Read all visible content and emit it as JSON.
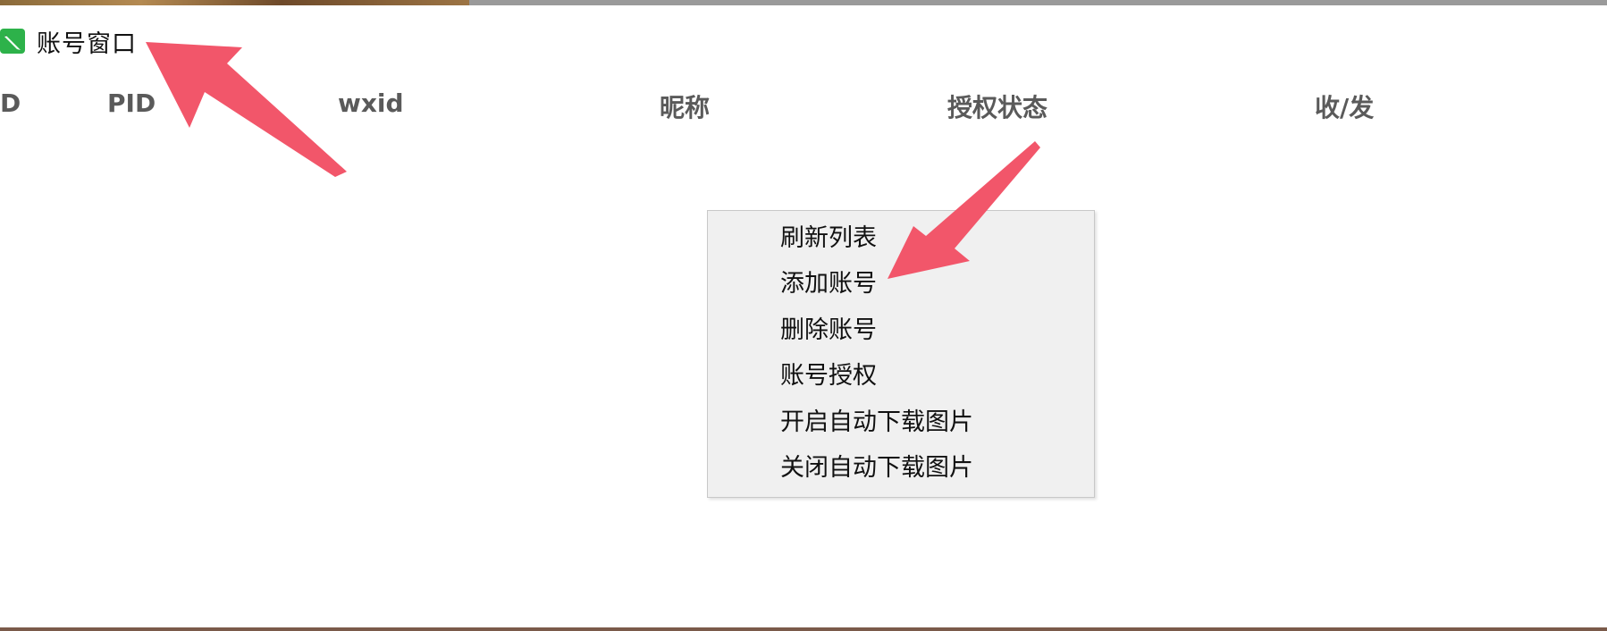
{
  "window": {
    "title": "账号窗口",
    "icon": "pen-app-icon"
  },
  "table": {
    "columns": [
      "D",
      "PID",
      "wxid",
      "昵称",
      "授权状态",
      "收/发"
    ],
    "rows": []
  },
  "context_menu": {
    "items": [
      "刷新列表",
      "添加账号",
      "删除账号",
      "账号授权",
      "开启自动下载图片",
      "关闭自动下载图片"
    ]
  },
  "colors": {
    "annotation_arrow": "#f2566a",
    "menu_background": "#f0f0f0",
    "header_text": "#5a5a5a",
    "icon_green": "#2db24a"
  }
}
